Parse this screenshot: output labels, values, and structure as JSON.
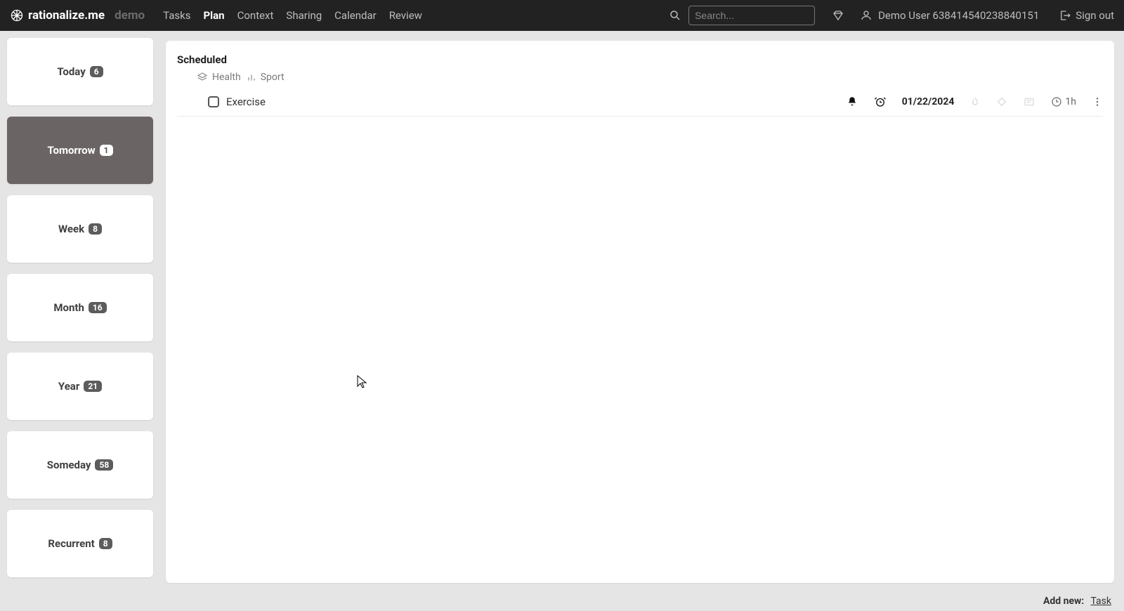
{
  "brand": "rationalize.me",
  "demo_label": "demo",
  "nav": {
    "tasks": "Tasks",
    "plan": "Plan",
    "context": "Context",
    "sharing": "Sharing",
    "calendar": "Calendar",
    "review": "Review"
  },
  "search": {
    "placeholder": "Search..."
  },
  "user": {
    "name": "Demo User 638414540238840151"
  },
  "signout": "Sign out",
  "sidebar": {
    "items": [
      {
        "label": "Today",
        "count": "6"
      },
      {
        "label": "Tomorrow",
        "count": "1"
      },
      {
        "label": "Week",
        "count": "8"
      },
      {
        "label": "Month",
        "count": "16"
      },
      {
        "label": "Year",
        "count": "21"
      },
      {
        "label": "Someday",
        "count": "58"
      },
      {
        "label": "Recurrent",
        "count": "8"
      }
    ],
    "active_index": 1
  },
  "panel": {
    "section_title": "Scheduled",
    "breadcrumb": {
      "group1": "Health",
      "group2": "Sport"
    },
    "task": {
      "title": "Exercise",
      "date": "01/22/2024",
      "duration": "1h"
    }
  },
  "addnew": {
    "label": "Add new:",
    "link": "Task"
  }
}
